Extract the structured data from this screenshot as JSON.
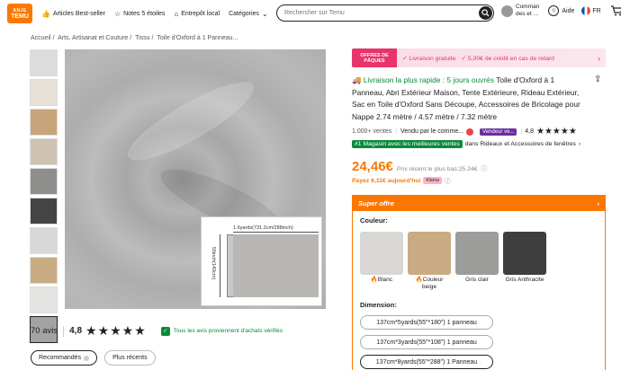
{
  "header": {
    "logo_top": "ANJE",
    "logo_bottom": "TEMU",
    "nav": [
      {
        "label": "Articles Best-seller",
        "icon": "thumbs-up-icon"
      },
      {
        "label": "Notes 5 étoiles",
        "icon": "star-icon"
      },
      {
        "label": "Entrepôt local",
        "icon": "warehouse-icon"
      },
      {
        "label": "Catégories",
        "icon": "chevron-down-icon"
      }
    ],
    "search_placeholder": "Rechercher sur Temu",
    "orders_label_1": "Comman",
    "orders_label_2": "des et ...",
    "help_label": "Aide",
    "lang_label": "FR"
  },
  "breadcrumb": [
    "Accueil",
    "Arts, Artisanat et Couture",
    "Tissu",
    "Toile d'Oxford à 1 Panneau..."
  ],
  "image": {
    "dim_top": "1.6yards(731.2cm/288inch)",
    "dim_side": "55inch(140cm)"
  },
  "reviews": {
    "count": "70 avis",
    "rating": "4,8",
    "stars": "★★★★★",
    "verified": "Tous les avis proviennent d'achats vérifiés",
    "filters": [
      "Recommandés",
      "Plus récents"
    ]
  },
  "promo": {
    "tag": "OFFRES DE PÂQUES",
    "free_shipping": "✓ Livraison gratuite",
    "credit": "✓ 5,00€ de crédit en cas de retard"
  },
  "product": {
    "fast": "Livraison la plus rapide : 5 jours ouvrés",
    "title": "Toile d'Oxford à 1 Panneau, Abri Extérieur Maison, Tente Extérieure, Rideau Extérieur, Sac en Toile d'Oxford Sans Découpe, Accessoires de Bricolage pour Nappe 2.74 mètre / 4.57 mètre / 7.32 mètre",
    "sales": "1.000+ ventes",
    "seller_prefix": "Vendu par le comme...",
    "seller_badge": "Vendeur ve...",
    "seller_rating": "4,8",
    "rank_badge": "#1 Magasin avec les meilleures ventes",
    "rank_text": "dans Rideaux et Accessoires de fenêtres",
    "price": "24,46€",
    "recent_low": "Prix récent le plus bas:25.24€",
    "pay_today": "Payez 6,11€ aujourd'hui",
    "klarna": "Klarna"
  },
  "super_offer": {
    "title": "Super offre",
    "couleur_label": "Couleur:",
    "colors": [
      {
        "label": "Blanc",
        "fire": true,
        "color": "#d9d7d3"
      },
      {
        "label": "Couleur beige",
        "fire": true,
        "color": "#c9ab84"
      },
      {
        "label": "Gris clair",
        "fire": false,
        "color": "#9c9c9a"
      },
      {
        "label": "Gris Anthracite",
        "fire": false,
        "color": "#3e3e3e"
      }
    ],
    "dimension_label": "Dimension:",
    "dimensions": [
      "137cm*5yards(55\"*180\") 1 panneau",
      "137cm*3yards(55\"*108\") 1 panneau",
      "137cm*8yards(55\"*288\") 1 Panneau"
    ]
  },
  "thumb_colors": [
    "#dcdcdc",
    "#e6e0d6",
    "#c8a47a",
    "#cfc4b2",
    "#8e8e8c",
    "#444444",
    "#d8d8d8",
    "#c9ab84",
    "#e4e4e2",
    "#a3a3a1"
  ]
}
